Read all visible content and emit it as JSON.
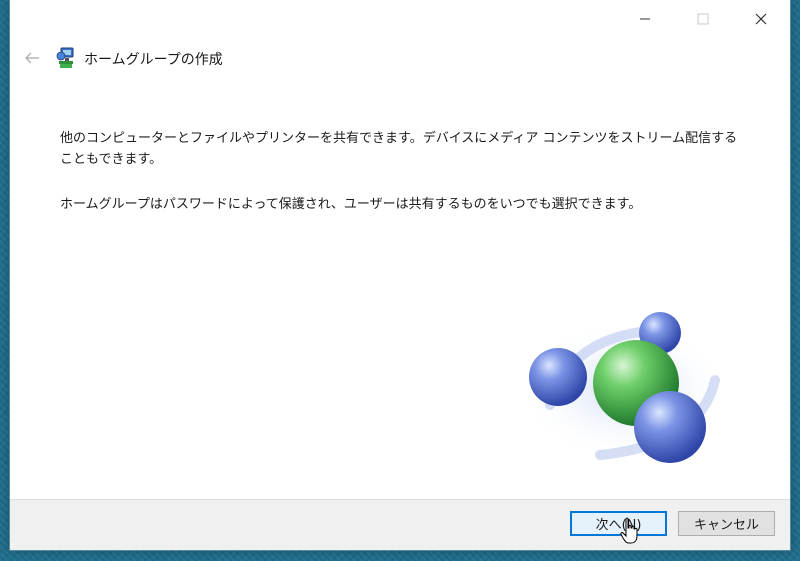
{
  "window": {
    "title": "ホームグループの作成",
    "caption_buttons": [
      "minimize-icon",
      "maximize-icon",
      "close-icon"
    ]
  },
  "nav": {
    "back_icon": "arrow-left-icon",
    "app_icon": "homegroup-icon"
  },
  "content": {
    "paragraph1": "他のコンピューターとファイルやプリンターを共有できます。デバイスにメディア コンテンツをストリーム配信することもできます。",
    "paragraph2": "ホームグループはパスワードによって保護され、ユーザーは共有するものをいつでも選択できます。"
  },
  "footer": {
    "next_label": "次へ(N)",
    "cancel_label": "キャンセル"
  },
  "colors": {
    "accent": "#0078d7",
    "desktop": "#1f6e8c",
    "sphere_blue": "#5a74d6",
    "sphere_green": "#3fae4e"
  }
}
